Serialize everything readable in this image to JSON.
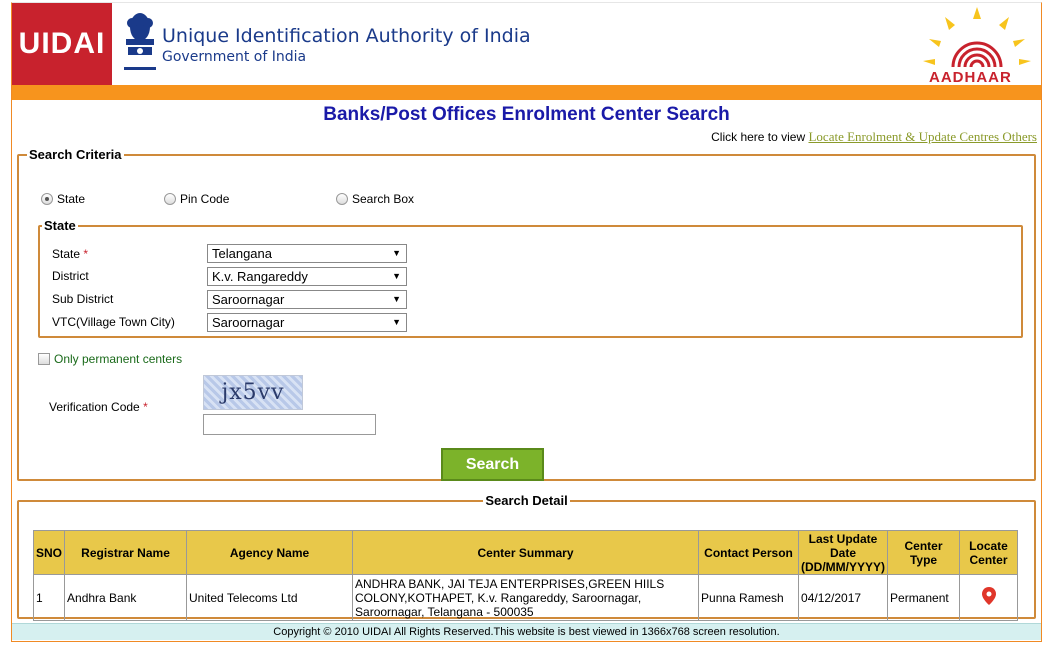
{
  "header": {
    "logo_text": "UIDAI",
    "org_title": "Unique Identification Authority of India",
    "org_subtitle": "Government of India",
    "aadhaar_text": "AADHAAR"
  },
  "page_title": "Banks/Post Offices Enrolment Center Search",
  "locate": {
    "prefix": "Click here to view",
    "link": "Locate Enrolment & Update Centres Others"
  },
  "criteria": {
    "legend": "Search Criteria",
    "radios": [
      {
        "label": "State",
        "selected": true
      },
      {
        "label": "Pin Code",
        "selected": false
      },
      {
        "label": "Search Box",
        "selected": false
      }
    ],
    "state_legend": "State",
    "fields": [
      {
        "label": "State",
        "required": true,
        "value": "Telangana"
      },
      {
        "label": "District",
        "required": false,
        "value": "K.v. Rangareddy"
      },
      {
        "label": "Sub District",
        "required": false,
        "value": "Saroornagar"
      },
      {
        "label": "VTC(Village Town City)",
        "required": false,
        "value": "Saroornagar"
      }
    ],
    "permanent_label": "Only permanent centers",
    "verification_label": "Verification Code",
    "captcha_text": "jx5vv",
    "captcha_value": "",
    "search_button": "Search"
  },
  "detail": {
    "legend": "Search Detail",
    "columns": [
      "SNO",
      "Registrar Name",
      "Agency Name",
      "Center Summary",
      "Contact Person",
      "Last Update Date (DD/MM/YYYY)",
      "Center Type",
      "Locate Center"
    ],
    "rows": [
      {
        "sno": "1",
        "registrar": "Andhra Bank",
        "agency": "United Telecoms Ltd",
        "summary": "ANDHRA BANK, JAI TEJA ENTERPRISES,GREEN HIILS COLONY,KOTHAPET, K.v. Rangareddy, Saroornagar, Saroornagar, Telangana - 500035",
        "contact": "Punna Ramesh",
        "date": "04/12/2017",
        "type": "Permanent"
      }
    ]
  },
  "footer": "Copyright © 2010 UIDAI All Rights Reserved.This website is best viewed in 1366x768 screen resolution.",
  "colors": {
    "accent": "#f7941d",
    "brand_red": "#c8222d",
    "title_blue": "#1a1aa8",
    "button_green": "#7cb32a",
    "table_header": "#e8c84a"
  }
}
